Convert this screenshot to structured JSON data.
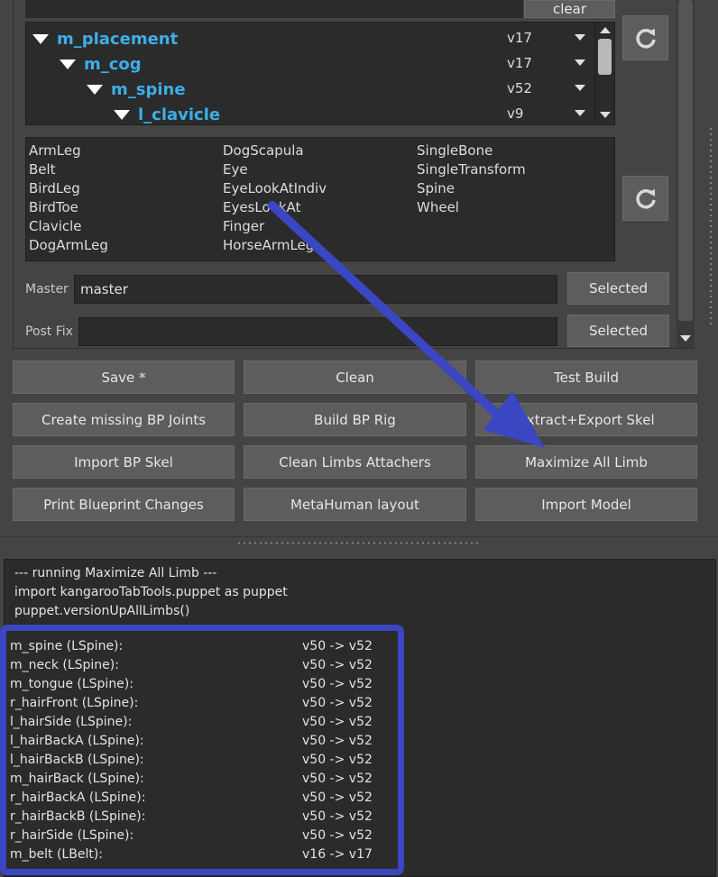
{
  "top": {
    "clear_label": "clear"
  },
  "tree": {
    "rows": [
      {
        "name": "m_placement",
        "version": "v17"
      },
      {
        "name": "m_cog",
        "version": "v17"
      },
      {
        "name": "m_spine",
        "version": "v52"
      },
      {
        "name": "l_clavicle",
        "version": "v9"
      }
    ]
  },
  "limbs": {
    "col1": [
      "ArmLeg",
      "Belt",
      "BirdLeg",
      "BirdToe",
      "Clavicle",
      "DogArmLeg"
    ],
    "col2": [
      "DogScapula",
      "Eye",
      "EyeLookAtIndiv",
      "EyesLookAt",
      "Finger",
      "HorseArmLeg"
    ],
    "col3": [
      "SingleBone",
      "SingleTransform",
      "Spine",
      "Wheel"
    ]
  },
  "master": {
    "label": "Master",
    "value": "master",
    "button": "Selected"
  },
  "postfix": {
    "label": "Post Fix",
    "value": "",
    "button": "Selected"
  },
  "buttons": {
    "row1": [
      "Save *",
      "Clean",
      "Test Build"
    ],
    "row2": [
      "Create missing BP Joints",
      "Build BP Rig",
      "Extract+Export Skel"
    ],
    "row3": [
      "Import BP Skel",
      "Clean Limbs Attachers",
      "Maximize All Limb"
    ],
    "row4": [
      "Print Blueprint Changes",
      "MetaHuman layout",
      "Import Model"
    ]
  },
  "console": {
    "header_lines": [
      "--- running Maximize All Limb ---",
      "import kangarooTabTools.puppet as puppet",
      "puppet.versionUpAllLimbs()"
    ],
    "results": [
      {
        "name": "m_spine (LSpine):",
        "change": "v50 -> v52"
      },
      {
        "name": "m_neck (LSpine):",
        "change": "v50 -> v52"
      },
      {
        "name": "m_tongue (LSpine):",
        "change": "v50 -> v52"
      },
      {
        "name": "r_hairFront (LSpine):",
        "change": "v50 -> v52"
      },
      {
        "name": "l_hairSide (LSpine):",
        "change": "v50 -> v52"
      },
      {
        "name": "l_hairBackA (LSpine):",
        "change": "v50 -> v52"
      },
      {
        "name": "l_hairBackB (LSpine):",
        "change": "v50 -> v52"
      },
      {
        "name": "m_hairBack (LSpine):",
        "change": "v50 -> v52"
      },
      {
        "name": "r_hairBackA (LSpine):",
        "change": "v50 -> v52"
      },
      {
        "name": "r_hairBackB (LSpine):",
        "change": "v50 -> v52"
      },
      {
        "name": "r_hairSide (LSpine):",
        "change": "v50 -> v52"
      },
      {
        "name": "m_belt (LBelt):",
        "change": "v16 -> v17"
      }
    ]
  },
  "colors": {
    "tree_text": "#3daee9",
    "annotation": "#3b46c2"
  },
  "icons": {
    "refresh": "refresh-icon",
    "expand": "triangle-down-icon"
  }
}
